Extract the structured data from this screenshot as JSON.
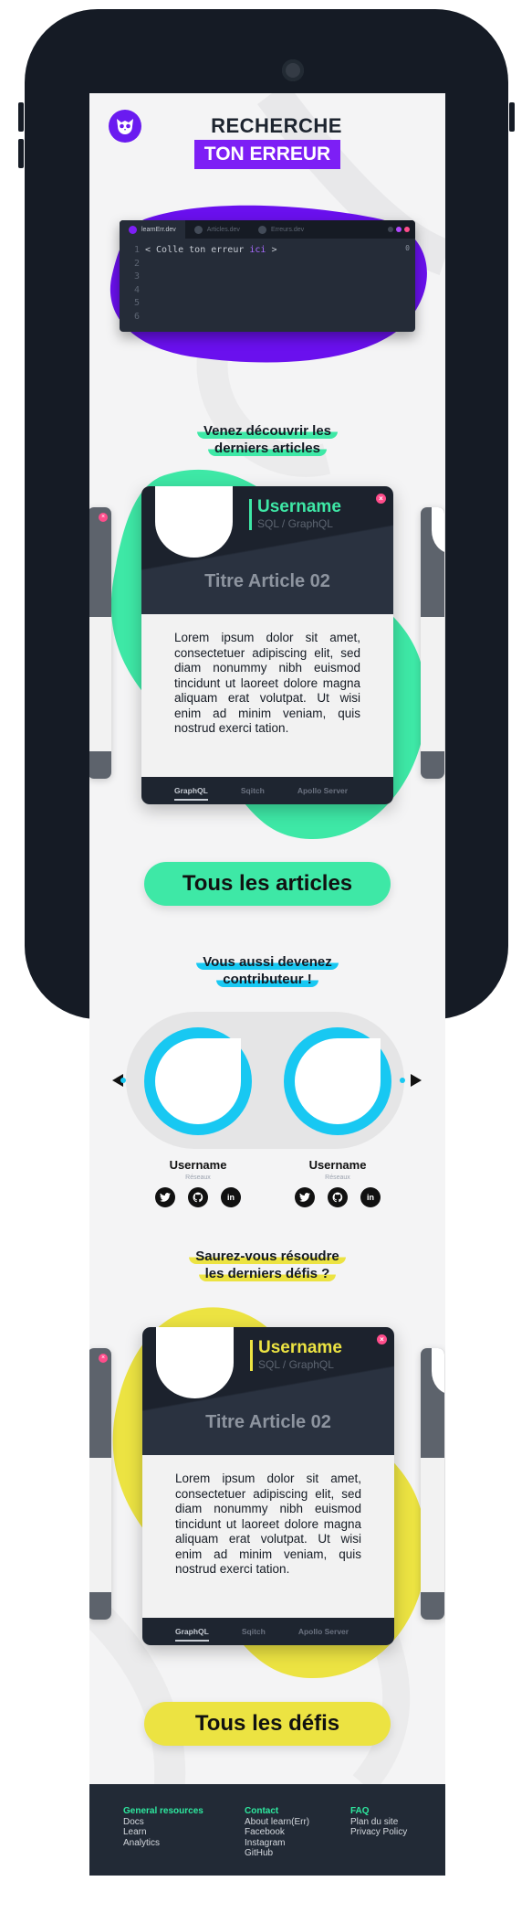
{
  "colors": {
    "purple": "#7d1ff5",
    "green": "#3ee8a6",
    "cyan": "#18c8f2",
    "yellow": "#ece342",
    "dark": "#1e2530",
    "pink": "#ff4d8b"
  },
  "hero": {
    "line1": "RECHERCHE",
    "line2": "TON ERREUR"
  },
  "editor": {
    "tabs": [
      "learnErr.dev",
      "Articles.dev",
      "Erreurs.dev"
    ],
    "line_numbers": [
      "1",
      "2",
      "3",
      "4",
      "5",
      "6"
    ],
    "code_prefix": "< Colle ton erreur ",
    "code_keyword": "ici",
    "code_suffix": " >",
    "count": "0"
  },
  "articles": {
    "heading_line1": "Venez découvrir les",
    "heading_line2": "derniers articles",
    "card": {
      "username": "Username",
      "subtitle": "SQL / GraphQL",
      "title": "Titre Article 02",
      "body": "Lorem ipsum dolor sit amet, consectetuer adipiscing elit, sed diam nonummy nibh euismod tincidunt ut laoreet dolore magna aliquam erat volutpat. Ut wisi enim ad minim veniam, quis nostrud exerci tation.",
      "tabs": [
        "GraphQL",
        "Sqitch",
        "Apollo Server"
      ]
    },
    "cta": "Tous les articles"
  },
  "contributors": {
    "heading_line1": "Vous aussi devenez",
    "heading_line2": "contributeur !",
    "people": [
      {
        "name": "Username",
        "role": "Réseaux"
      },
      {
        "name": "Username",
        "role": "Réseaux"
      }
    ],
    "social_icons": [
      "twitter-icon",
      "github-icon",
      "linkedin-icon"
    ]
  },
  "challenges": {
    "heading_line1": "Saurez-vous résoudre",
    "heading_line2": "les derniers défis ?",
    "card": {
      "username": "Username",
      "subtitle": "SQL / GraphQL",
      "title": "Titre Article 02",
      "body": "Lorem ipsum dolor sit amet, consectetuer adipiscing elit, sed diam nonummy nibh euismod tincidunt ut laoreet dolore magna aliquam erat volutpat. Ut wisi enim ad minim veniam, quis nostrud exerci tation.",
      "tabs": [
        "GraphQL",
        "Sqitch",
        "Apollo Server"
      ]
    },
    "cta": "Tous les défis"
  },
  "footer": {
    "col1": {
      "title": "General resources",
      "links": [
        "Docs",
        "Learn",
        "Analytics"
      ]
    },
    "col2": {
      "title": "Contact",
      "links": [
        "About learn(Err)",
        "Facebook",
        "Instagram",
        "GitHub"
      ]
    },
    "col3": {
      "title": "FAQ",
      "links": [
        "Plan du site",
        "Privacy Policy"
      ]
    }
  }
}
